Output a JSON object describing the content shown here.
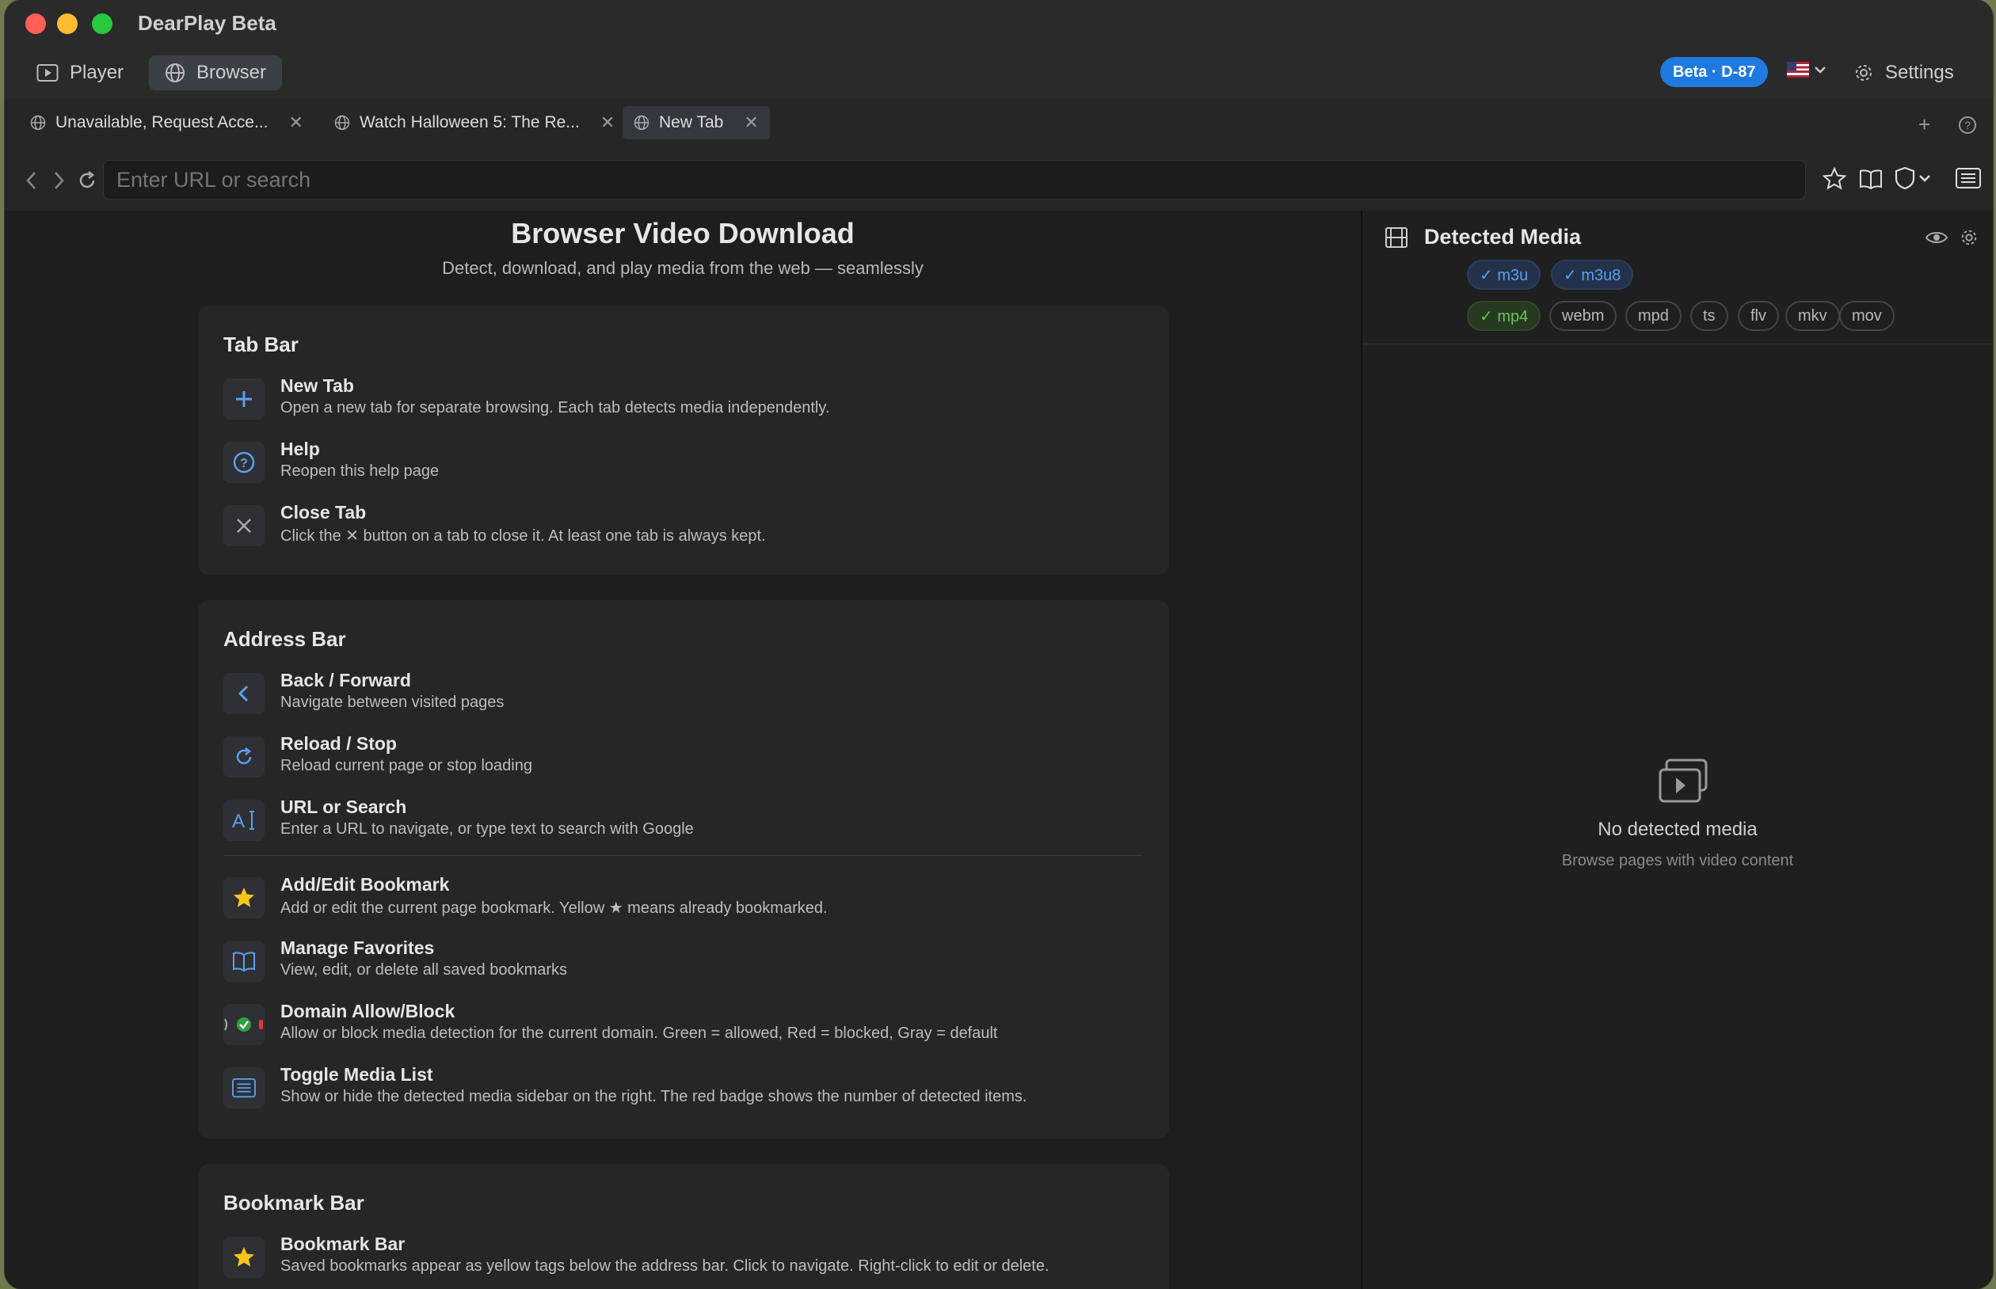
{
  "app": {
    "title": "DearPlay Beta"
  },
  "modes": {
    "player": "Player",
    "browser": "Browser"
  },
  "header": {
    "beta_badge": "Beta · D-87",
    "settings": "Settings"
  },
  "tabs": [
    {
      "label": "Unavailable, Request Acce...",
      "active": false
    },
    {
      "label": "Watch Halloween 5: The Re...",
      "active": false
    },
    {
      "label": "New Tab",
      "active": true
    }
  ],
  "address": {
    "placeholder": "Enter URL or search",
    "value": ""
  },
  "page": {
    "title": "Browser Video Download",
    "subtitle": "Detect, download, and play media from the web — seamlessly"
  },
  "sections": {
    "tab_bar": {
      "title": "Tab Bar",
      "items": [
        {
          "title": "New Tab",
          "desc": "Open a new tab for separate browsing. Each tab detects media independently."
        },
        {
          "title": "Help",
          "desc": "Reopen this help page"
        },
        {
          "title": "Close Tab",
          "desc": "Click the ✕ button on a tab to close it. At least one tab is always kept."
        }
      ]
    },
    "address_bar": {
      "title": "Address Bar",
      "items": [
        {
          "title": "Back / Forward",
          "desc": "Navigate between visited pages"
        },
        {
          "title": "Reload / Stop",
          "desc": "Reload current page or stop loading"
        },
        {
          "title": "URL or Search",
          "desc": "Enter a URL to navigate, or type text to search with Google"
        },
        {
          "title": "Add/Edit Bookmark",
          "desc": "Add or edit the current page bookmark. Yellow ★ means already bookmarked."
        },
        {
          "title": "Manage Favorites",
          "desc": "View, edit, or delete all saved bookmarks"
        },
        {
          "title": "Domain Allow/Block",
          "desc": "Allow or block media detection for the current domain. Green = allowed, Red = blocked, Gray = default"
        },
        {
          "title": "Toggle Media List",
          "desc": "Show or hide the detected media sidebar on the right. The red badge shows the number of detected items."
        }
      ]
    },
    "bookmark_bar": {
      "title": "Bookmark Bar",
      "items": [
        {
          "title": "Bookmark Bar",
          "desc": "Saved bookmarks appear as yellow tags below the address bar. Click to navigate. Right-click to edit or delete."
        }
      ]
    }
  },
  "sidebar": {
    "title": "Detected Media",
    "filters": [
      {
        "label": "✓ m3u",
        "state": "on-blue"
      },
      {
        "label": "✓ m3u8",
        "state": "on-blue"
      },
      {
        "label": "✓ mp4",
        "state": "on-green"
      },
      {
        "label": "webm",
        "state": "off"
      },
      {
        "label": "mpd",
        "state": "off"
      },
      {
        "label": "ts",
        "state": "off"
      },
      {
        "label": "flv",
        "state": "off"
      },
      {
        "label": "mkv",
        "state": "off"
      },
      {
        "label": "mov",
        "state": "off"
      }
    ],
    "empty_title": "No detected media",
    "empty_subtitle": "Browse pages with video content"
  },
  "colors": {
    "accent": "#1f7ae0",
    "star": "#f5c518",
    "allowed": "#2ea043",
    "blocked": "#d73a3a"
  }
}
